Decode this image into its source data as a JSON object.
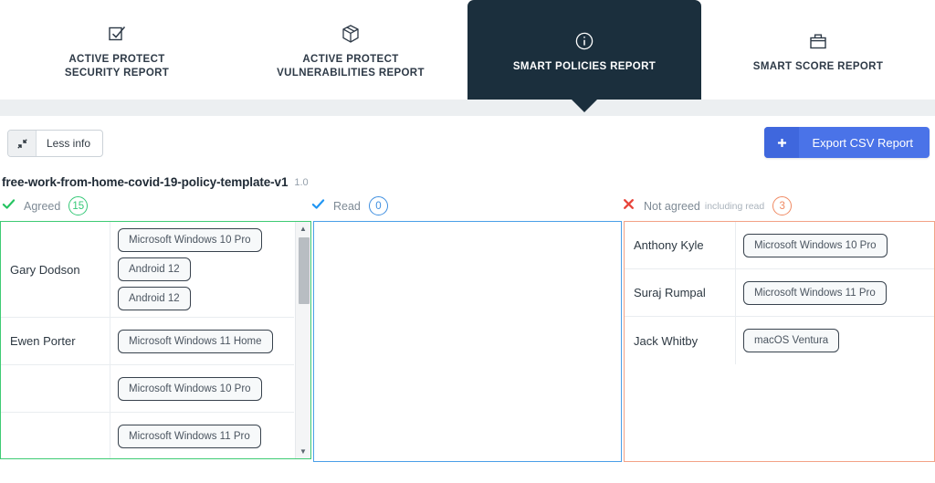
{
  "tabs": [
    {
      "label": "ACTIVE PROTECT\nSECURITY REPORT",
      "icon": "checkbox-checked-icon",
      "active": false
    },
    {
      "label": "ACTIVE PROTECT\nVULNERABILITIES REPORT",
      "icon": "package-box-icon",
      "active": false
    },
    {
      "label": "SMART POLICIES REPORT",
      "icon": "info-circle-icon",
      "active": true
    },
    {
      "label": "SMART SCORE REPORT",
      "icon": "briefcase-icon",
      "active": false
    }
  ],
  "toolbar": {
    "less_info_label": "Less info",
    "less_info_icon": "collapse-arrows-icon",
    "export_label": "Export CSV Report",
    "export_icon": "plus-icon"
  },
  "policy": {
    "name": "free-work-from-home-covid-19-policy-template-v1",
    "version": "1.0"
  },
  "columns": {
    "agreed": {
      "label": "Agreed",
      "count": "15",
      "icon": "green-check-icon",
      "accent": "#3fcb74"
    },
    "read": {
      "label": "Read",
      "count": "0",
      "icon": "blue-check-icon",
      "accent": "#4a9fe8"
    },
    "not_agreed": {
      "label": "Not agreed",
      "sublabel": "including read",
      "count": "3",
      "icon": "red-x-icon",
      "accent": "#f3a286"
    }
  },
  "agreed_rows": [
    {
      "name": "Gary Dodson",
      "devices": [
        "Microsoft Windows 10 Pro",
        "Android 12",
        "Android 12"
      ]
    },
    {
      "name": "Ewen Porter",
      "devices": [
        "Microsoft Windows 11 Home"
      ]
    },
    {
      "name": "",
      "devices": [
        "Microsoft Windows 10 Pro"
      ]
    },
    {
      "name": "",
      "devices": [
        "Microsoft Windows 11 Pro"
      ]
    }
  ],
  "read_rows": [],
  "not_agreed_rows": [
    {
      "name": "Anthony Kyle",
      "devices": [
        "Microsoft Windows 10 Pro"
      ]
    },
    {
      "name": "Suraj Rumpal",
      "devices": [
        "Microsoft Windows 11 Pro"
      ]
    },
    {
      "name": "Jack Whitby",
      "devices": [
        "macOS Ventura"
      ]
    }
  ]
}
